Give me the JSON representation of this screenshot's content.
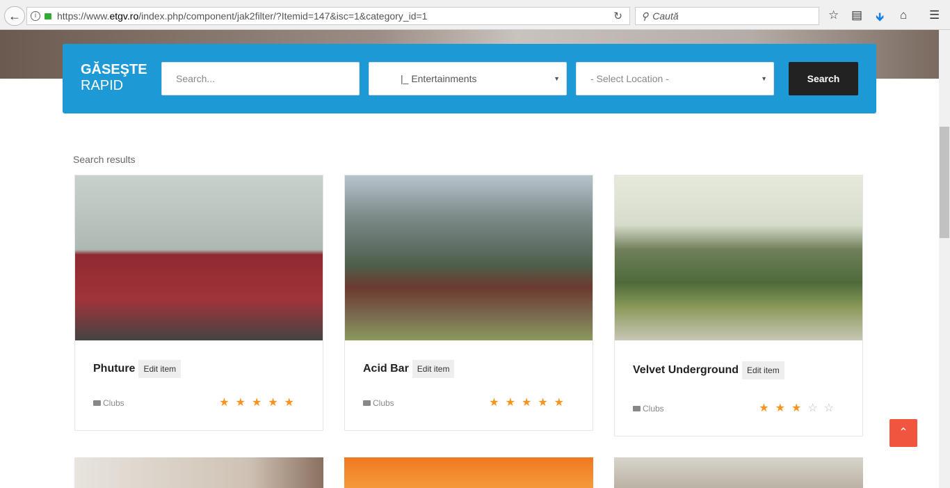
{
  "browser": {
    "url_prefix": "https://www.",
    "url_host": "etgv.ro",
    "url_path": "/index.php/component/jak2filter/?Itemid=147&isc=1&category_id=1",
    "search_placeholder": "Caută"
  },
  "filter": {
    "brand_line1": "GĂSEŞTE",
    "brand_line2": "RAPID",
    "search_placeholder": "Search...",
    "category": "|_ Entertainments",
    "location": "- Select Location -",
    "search_button": "Search"
  },
  "results_label": "Search results",
  "items": [
    {
      "title": "Phuture",
      "edit": "Edit item",
      "category": "Clubs",
      "rating": 5
    },
    {
      "title": "Acid Bar",
      "edit": "Edit item",
      "category": "Clubs",
      "rating": 5
    },
    {
      "title": "Velvet Underground",
      "edit": "Edit item",
      "category": "Clubs",
      "rating": 3
    }
  ],
  "colors": {
    "accent": "#1d9ad6",
    "star": "#f7941d",
    "totop": "#f0553f"
  }
}
